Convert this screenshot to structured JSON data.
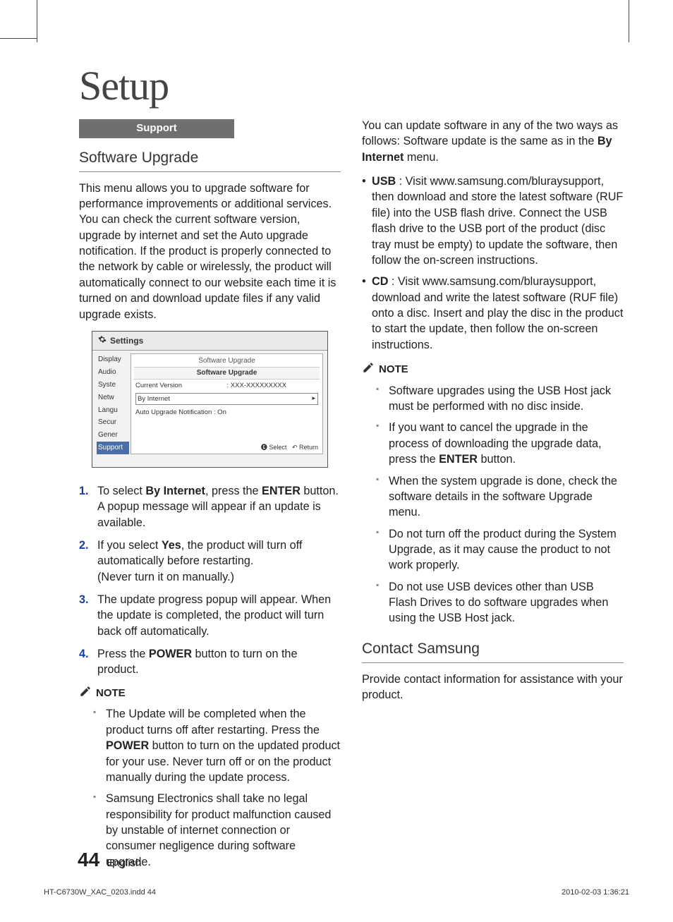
{
  "title": "Setup",
  "support_label": "Support",
  "left": {
    "sub1": "Software Upgrade",
    "intro": "This menu allows you to upgrade software for performance improvements or additional services. You can check the current software version, upgrade by internet and set the Auto upgrade notification. If the product is properly connected to the network by cable or wirelessly, the product will automatically connect to our website each time it is turned on and download update files if any valid upgrade exists.",
    "screenshot": {
      "settings": "Settings",
      "sidebar": [
        "Display",
        "Audio",
        "Syste",
        "Netw",
        "Langu",
        "Secur",
        "Gener",
        "Support"
      ],
      "panel_title": "Software Upgrade",
      "panel_title2": "Software Upgrade",
      "current_version_label": "Current Version",
      "current_version_value": ": XXX-XXXXXXXXX",
      "by_internet": "By Internet",
      "auto_upgrade": "Auto Upgrade Notification   : On",
      "footer_select": "Select",
      "footer_return": "Return"
    },
    "steps": [
      {
        "num": "1.",
        "a": "To select ",
        "b": "By Internet",
        "c": ", press the ",
        "d": "ENTER",
        "e": " button.",
        "f": "A popup message will appear if an update is available."
      },
      {
        "num": "2.",
        "a": "If you select ",
        "b": "Yes",
        "c": ", the product will turn off automatically before restarting.",
        "f": "(Never turn it on manually.)"
      },
      {
        "num": "3.",
        "a": "The update progress popup will appear. When the update is completed, the product will turn back off automatically."
      },
      {
        "num": "4.",
        "a": "Press the ",
        "b": "POWER",
        "c": " button to turn on the product."
      }
    ],
    "note_label": "NOTE",
    "notes": [
      {
        "a": "The Update will be completed when the product turns off after restarting. Press the ",
        "b": "POWER",
        "c": " button to turn on the updated product for your use. Never turn off or on the product manually during the update process."
      },
      {
        "a": "Samsung Electronics shall take no legal responsibility for product malfunction caused by unstable of internet connection or consumer negligence during software upgrade."
      }
    ]
  },
  "right": {
    "intro_a": "You can update software in any of the two ways as follows: Software update is the same as in the ",
    "intro_b": "By Internet",
    "intro_c": " menu.",
    "bullets": [
      {
        "b": "USB",
        "t": " : Visit www.samsung.com/bluraysupport, then download and store the latest software (RUF file) into the USB flash drive. Connect the USB flash drive to the USB port of the product (disc tray must be empty) to update the software, then follow the on-screen instructions."
      },
      {
        "b": "CD",
        "t": " : Visit www.samsung.com/bluraysupport, download and write the latest software (RUF file) onto a disc. Insert and play the disc in the product to start the update, then follow the on-screen instructions."
      }
    ],
    "note_label": "NOTE",
    "notes": [
      "Software upgrades using the USB Host jack must be performed with no disc inside.",
      "If you want to cancel the upgrade in the process of downloading the upgrade data, press the ENTER button.",
      "When the system upgrade is done, check the software details in the software Upgrade menu.",
      "Do not turn off the product during the System Upgrade, as it may cause the product to not work properly.",
      "Do not use USB devices other than USB Flash Drives to do software upgrades when using the USB Host jack."
    ],
    "note2_bold_idx": 1,
    "note2_bold_word": "ENTER",
    "sub2": "Contact Samsung",
    "contact_text": "Provide contact information for assistance with your product."
  },
  "footer": {
    "page": "44",
    "lang": "English"
  },
  "indd": "HT-C6730W_XAC_0203.indd   44",
  "indd_right": "2010-02-03    1:36:21"
}
